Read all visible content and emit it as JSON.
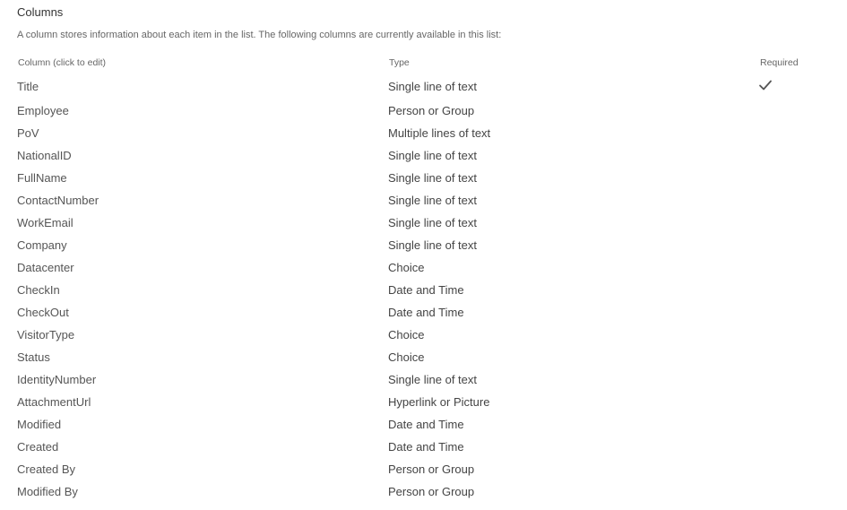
{
  "section": {
    "title": "Columns",
    "description": "A column stores information about each item in the list. The following columns are currently available in this list:"
  },
  "table": {
    "headers": {
      "name": "Column (click to edit)",
      "type": "Type",
      "required": "Required"
    },
    "rows": [
      {
        "name": "Title",
        "type": "Single line of text",
        "required": true
      },
      {
        "name": "Employee",
        "type": "Person or Group",
        "required": false
      },
      {
        "name": "PoV",
        "type": "Multiple lines of text",
        "required": false
      },
      {
        "name": "NationalID",
        "type": "Single line of text",
        "required": false
      },
      {
        "name": "FullName",
        "type": "Single line of text",
        "required": false
      },
      {
        "name": "ContactNumber",
        "type": "Single line of text",
        "required": false
      },
      {
        "name": "WorkEmail",
        "type": "Single line of text",
        "required": false
      },
      {
        "name": "Company",
        "type": "Single line of text",
        "required": false
      },
      {
        "name": "Datacenter",
        "type": "Choice",
        "required": false
      },
      {
        "name": "CheckIn",
        "type": "Date and Time",
        "required": false
      },
      {
        "name": "CheckOut",
        "type": "Date and Time",
        "required": false
      },
      {
        "name": "VisitorType",
        "type": "Choice",
        "required": false
      },
      {
        "name": "Status",
        "type": "Choice",
        "required": false
      },
      {
        "name": "IdentityNumber",
        "type": "Single line of text",
        "required": false
      },
      {
        "name": "AttachmentUrl",
        "type": "Hyperlink or Picture",
        "required": false
      },
      {
        "name": "Modified",
        "type": "Date and Time",
        "required": false
      },
      {
        "name": "Created",
        "type": "Date and Time",
        "required": false
      },
      {
        "name": "Created By",
        "type": "Person or Group",
        "required": false
      },
      {
        "name": "Modified By",
        "type": "Person or Group",
        "required": false
      }
    ]
  },
  "icons": {
    "required_check": "checkmark-icon"
  },
  "colors": {
    "text_primary": "#444444",
    "text_secondary": "#666666",
    "checkmark": "#555555"
  }
}
